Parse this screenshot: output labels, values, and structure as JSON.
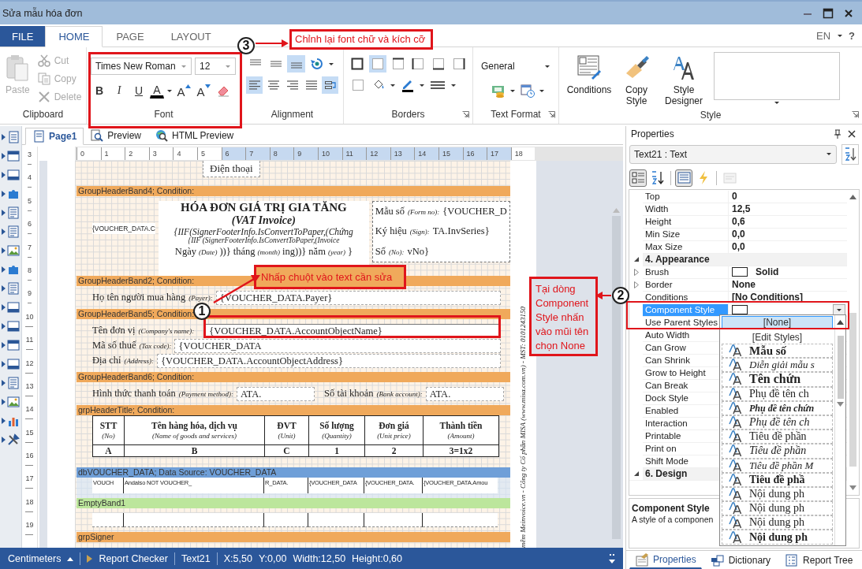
{
  "window": {
    "title": "Sửa mẫu hóa đơn"
  },
  "ribbon_tabs": [
    {
      "label": "FILE",
      "kind": "file",
      "selected": false
    },
    {
      "label": "HOME",
      "kind": "tab",
      "selected": true
    },
    {
      "label": "PAGE",
      "kind": "tab",
      "selected": false
    },
    {
      "label": "LAYOUT",
      "kind": "tab",
      "selected": false
    }
  ],
  "language": "EN",
  "help": "?",
  "ribbon": {
    "clipboard": {
      "title": "Clipboard",
      "paste": {
        "label": "Paste",
        "disabled": true
      },
      "items": [
        {
          "label": "Cut",
          "kind": "cut",
          "disabled": true
        },
        {
          "label": "Copy",
          "kind": "copy",
          "disabled": true
        },
        {
          "label": "Delete",
          "kind": "delete",
          "disabled": true
        }
      ]
    },
    "font": {
      "title": "Font",
      "family": "Times New Roman",
      "size": "12",
      "buttons": [
        {
          "kind": "bold",
          "label": "B"
        },
        {
          "kind": "italic",
          "label": "I"
        },
        {
          "kind": "underline",
          "label": "U"
        },
        {
          "kind": "color",
          "label": "A"
        },
        {
          "kind": "grow",
          "label": "A"
        },
        {
          "kind": "shrink",
          "label": "A"
        },
        {
          "kind": "clear"
        }
      ]
    },
    "alignment": {
      "title": "Alignment",
      "rows": [
        {
          "buttons": [
            {
              "kind": "top",
              "selected": false
            },
            {
              "kind": "middle",
              "selected": false
            },
            {
              "kind": "bottom",
              "selected": true
            },
            {
              "kind": "rotate",
              "selected": false
            }
          ]
        },
        {
          "buttons": [
            {
              "kind": "left",
              "selected": true
            },
            {
              "kind": "center",
              "selected": false
            },
            {
              "kind": "right",
              "selected": false
            },
            {
              "kind": "justify",
              "selected": false
            },
            {
              "kind": "wrap",
              "selected": true
            }
          ]
        }
      ]
    },
    "borders": {
      "title": "Borders",
      "rows": [
        {
          "buttons": [
            {
              "kind": "outer",
              "selected": false
            },
            {
              "kind": "all",
              "selected": true
            },
            {
              "kind": "top",
              "selected": false
            },
            {
              "kind": "left",
              "selected": false
            },
            {
              "kind": "bottom",
              "selected": false
            },
            {
              "kind": "right",
              "selected": false
            }
          ]
        },
        {
          "buttons": [
            {
              "kind": "none",
              "selected": false
            },
            {
              "kind": "fill",
              "selected": false
            },
            {
              "kind": "pen",
              "selected": false
            },
            {
              "kind": "line",
              "selected": false
            }
          ]
        }
      ]
    },
    "text_format": {
      "title": "Text Format",
      "format": "General"
    },
    "style": {
      "title": "Style",
      "buttons": [
        {
          "label": "Conditions",
          "kind": "conditions"
        },
        {
          "label": "Copy Style",
          "kind": "copy"
        },
        {
          "label": "Style Designer",
          "kind": "designer"
        }
      ]
    }
  },
  "document": {
    "tabs": [
      {
        "label": "Page1",
        "kind": "page",
        "selected": true
      },
      {
        "label": "Preview",
        "kind": "preview",
        "selected": false
      },
      {
        "label": "HTML Preview",
        "kind": "html",
        "selected": false
      }
    ],
    "ruler": [
      {
        "label": "0",
        "selected": false
      },
      {
        "label": "1",
        "selected": false
      },
      {
        "label": "2",
        "selected": false
      },
      {
        "label": "3",
        "selected": false
      },
      {
        "label": "4",
        "selected": false
      },
      {
        "label": "5",
        "selected": false
      },
      {
        "label": "6",
        "selected": true
      },
      {
        "label": "7",
        "selected": true
      },
      {
        "label": "8",
        "selected": true
      },
      {
        "label": "9",
        "selected": true
      },
      {
        "label": "10",
        "selected": true
      },
      {
        "label": "11",
        "selected": true
      },
      {
        "label": "12",
        "selected": true
      },
      {
        "label": "13",
        "selected": true
      },
      {
        "label": "14",
        "selected": true
      },
      {
        "label": "15",
        "selected": true
      },
      {
        "label": "16",
        "selected": true
      },
      {
        "label": "17",
        "selected": true
      },
      {
        "label": "18",
        "selected": false
      }
    ],
    "vertical_ruler": [
      "3",
      "4",
      "5",
      "6",
      "7",
      "8",
      "9",
      "10",
      "11",
      "12",
      "13",
      "14",
      "15",
      "16",
      "17",
      "18",
      "19"
    ]
  },
  "report": {
    "top_text": "Điện thoại",
    "vertical_note": "mềm Meinvoice.vn - Công ty Cổ phần MISA (www.misa.com.vn) - MST: 0101243150",
    "bands": [
      {
        "kind": "title-block",
        "title": "GroupHeaderBand4; Condition:",
        "left": "{VOUCHER_DATA.C",
        "heading": "HÓA ĐƠN GIÁ TRỊ GIA TĂNG",
        "subheading": "(VAT Invoice)",
        "formula_lines": [
          "{IIF(SignerFooterInfo.IsConvertToPaper,(Chứng",
          "{IIF (SignerFooterInfo.IsConvertToPaper,(Invoice"
        ],
        "date_parts": [
          {
            "label": "Ngày",
            "hint": "(Date)",
            "value": "))}"
          },
          {
            "label": "tháng",
            "hint": "(month)",
            "value": "ing))}"
          },
          {
            "label": "năm",
            "hint": "(year)",
            "value": "}"
          }
        ],
        "info": [
          {
            "label": "Mẫu số",
            "hint": "(Form no):",
            "value": "{VOUCHER_D"
          },
          {
            "label": "Ký hiệu",
            "hint": "(Sign):",
            "value": "TA.InvSeries}"
          },
          {
            "label": "Số",
            "hint": "(No):",
            "value": "vNo}"
          }
        ]
      },
      {
        "kind": "fields",
        "title": "GroupHeaderBand2; Condition:",
        "lines": [
          {
            "fields": [
              {
                "label": "Họ tên người mua hàng",
                "hint": "(Payer):",
                "value": "{VOUCHER_DATA.Payer}",
                "selected": false
              }
            ]
          }
        ]
      },
      {
        "kind": "fields",
        "title": "GroupHeaderBand5; Condition:",
        "lines": [
          {
            "fields": [
              {
                "label": "Tên đơn vị",
                "hint": "(Company's name):",
                "value": "{VOUCHER_DATA.AccountObjectName}",
                "selected": true
              }
            ]
          },
          {
            "fields": [
              {
                "label": "Mã số thuế",
                "hint": "(Tax code):",
                "value": "{VOUCHER_DATA",
                "selected": false
              }
            ]
          },
          {
            "fields": [
              {
                "label": "Địa chỉ",
                "hint": "(Address):",
                "value": "{VOUCHER_DATA.AccountObjectAddress}",
                "selected": false
              }
            ]
          }
        ]
      },
      {
        "kind": "fields",
        "title": "GroupHeaderBand6; Condition:",
        "lines": [
          {
            "fields": [
              {
                "label": "Hình thức thanh toán",
                "hint": "(Payment method):",
                "value": "ATA.",
                "selected": false
              },
              {
                "label": "Số tài khoản",
                "hint": "(Bank account):",
                "value": "ATA.",
                "selected": false
              }
            ]
          }
        ]
      },
      {
        "kind": "table",
        "title": "grpHeaderTitle; Condition:",
        "columns": [
          {
            "title": "STT",
            "subtitle": "(No)",
            "code": "A"
          },
          {
            "title": "Tên hàng hóa, dịch vụ",
            "subtitle": "(Name of goods and services)",
            "code": "B"
          },
          {
            "title": "ĐVT",
            "subtitle": "(Unit)",
            "code": "C"
          },
          {
            "title": "Số lượng",
            "subtitle": "(Quantity)",
            "code": "1"
          },
          {
            "title": "Đơn giá",
            "subtitle": "(Unit price)",
            "code": "2"
          },
          {
            "title": "Thành tiền",
            "subtitle": "(Amount)",
            "code": "3=1x2"
          }
        ]
      },
      {
        "kind": "data-cells",
        "title": "dbVOUCHER_DATA; Data Source: VOUCHER_DATA",
        "cells": [
          "VOUCH",
          "AndaIso NOT VOUCHER_",
          "R_DATA.",
          "{VOUCHER_DATA",
          "{VOUCHER_DATA.",
          "{VOUCHER_DATA.Amou"
        ]
      },
      {
        "kind": "blank-columns",
        "title": "EmptyBand1"
      },
      {
        "kind": "empty-group",
        "title": "grpSigner"
      }
    ]
  },
  "properties": {
    "title": "Properties",
    "object": "Text21 : Text",
    "toolbar": [
      {
        "kind": "categorized",
        "selected": true,
        "disabled": false
      },
      {
        "kind": "alphabetical",
        "selected": false,
        "disabled": false
      },
      {
        "kind": "list",
        "selected": true,
        "disabled": false
      },
      {
        "kind": "events",
        "selected": false,
        "disabled": false
      },
      {
        "kind": "other",
        "selected": false,
        "disabled": true
      }
    ],
    "rows": [
      {
        "kind": "prop",
        "name": "Top",
        "value": "0",
        "selected": false
      },
      {
        "kind": "prop",
        "name": "Width",
        "value": "12,5",
        "selected": false
      },
      {
        "kind": "prop",
        "name": "Height",
        "value": "0,6",
        "selected": false
      },
      {
        "kind": "prop",
        "name": "Min Size",
        "value": "0,0",
        "selected": false
      },
      {
        "kind": "prop",
        "name": "Max Size",
        "value": "0,0",
        "selected": false
      },
      {
        "kind": "category",
        "name": "4. Appearance",
        "expanded": true
      },
      {
        "kind": "prop",
        "name": "Brush",
        "value": "Solid",
        "swatch": true,
        "expanded": false,
        "selected": false
      },
      {
        "kind": "prop",
        "name": "Border",
        "value": "None",
        "expanded": false,
        "selected": false
      },
      {
        "kind": "prop",
        "name": "Conditions",
        "value": "[No Conditions]",
        "selected": false
      },
      {
        "kind": "prop",
        "name": "Component Style",
        "swatch": true,
        "dropdown": true,
        "selected": true
      },
      {
        "kind": "prop",
        "name": "Use Parent Styles",
        "selected": false
      },
      {
        "kind": "prop",
        "name": "Auto Width",
        "selected": false
      },
      {
        "kind": "prop",
        "name": "Can Grow",
        "selected": false
      },
      {
        "kind": "prop",
        "name": "Can Shrink",
        "selected": false
      },
      {
        "kind": "prop",
        "name": "Grow to Height",
        "selected": false
      },
      {
        "kind": "prop",
        "name": "Can Break",
        "selected": false
      },
      {
        "kind": "prop",
        "name": "Dock Style",
        "selected": false
      },
      {
        "kind": "prop",
        "name": "Enabled",
        "selected": false
      },
      {
        "kind": "prop",
        "name": "Interaction",
        "selected": false
      },
      {
        "kind": "prop",
        "name": "Printable",
        "selected": false
      },
      {
        "kind": "prop",
        "name": "Print on",
        "selected": false
      },
      {
        "kind": "prop",
        "name": "Shift Mode",
        "selected": false
      },
      {
        "kind": "category",
        "name": "6. Design",
        "expanded": true
      }
    ],
    "description": {
      "title": "Component Style",
      "text": "A style of a componen"
    },
    "dropdown": {
      "items": [
        {
          "label": "[None]",
          "selected": true
        },
        {
          "label": "[Edit Styles]",
          "selected": false
        }
      ],
      "styles": [
        {
          "label": "Mẫu số",
          "kind": "bold"
        },
        {
          "label": "Diễn giải mẫu s",
          "kind": "italic"
        },
        {
          "label": "Tên chứn",
          "kind": "title"
        },
        {
          "label": "Phụ đề tên ch",
          "kind": "large"
        },
        {
          "label": "Phụ đề tên chứn",
          "kind": "bold-italic"
        },
        {
          "label": "Phụ đề tên ch",
          "kind": "large-italic"
        },
        {
          "label": "Tiêu đề phần",
          "kind": "large"
        },
        {
          "label": "Tiêu đề phần",
          "kind": "large-italic"
        },
        {
          "label": "Tiêu đề phần M",
          "kind": "italic"
        },
        {
          "label": "Tiêu đề phầ",
          "kind": "large-bold"
        },
        {
          "label": "Nội dung ph",
          "kind": "large"
        },
        {
          "label": "Nội dung ph",
          "kind": "large"
        },
        {
          "label": "Nội dung ph",
          "kind": "large"
        },
        {
          "label": "Nội dung ph",
          "kind": "large-bold"
        }
      ]
    },
    "tabs": [
      {
        "label": "Properties",
        "kind": "properties",
        "selected": true
      },
      {
        "label": "Dictionary",
        "kind": "dictionary",
        "selected": false
      },
      {
        "label": "Report Tree",
        "kind": "tree",
        "selected": false
      }
    ]
  },
  "status_bar": {
    "units": "Centimeters",
    "checker": "Report Checker",
    "items": [
      "Text21",
      "X:5,50",
      "Y:0,00",
      "Width:12,50",
      "Height:0,60"
    ]
  },
  "annotations": [
    {
      "number": "3",
      "text": "Chỉnh lại font chữ và kích cỡ"
    },
    {
      "number": "1",
      "text": "Nhấp chuột vào text cần sửa"
    },
    {
      "number": "2",
      "text": "Tại dòng Component Style nhấn vào mũi tên chọn None"
    }
  ]
}
